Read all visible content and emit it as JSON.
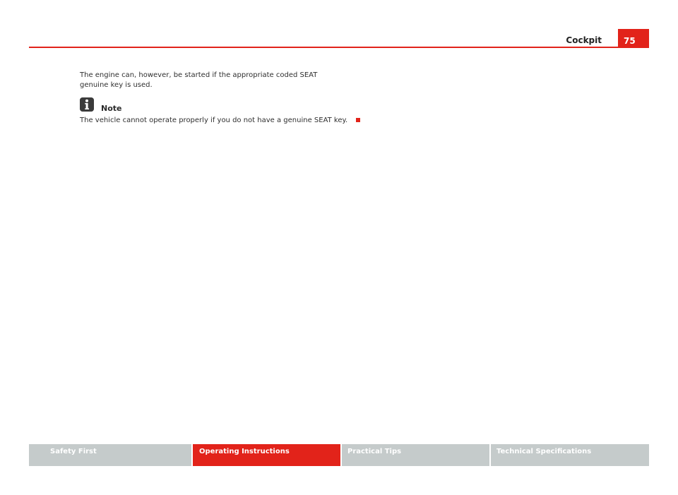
{
  "header": {
    "section_title": "Cockpit",
    "page_number": "75"
  },
  "content": {
    "paragraph": "The engine can, however, be started if the appropriate coded SEAT genuine key is used.",
    "note": {
      "icon": "info-i-icon",
      "heading": "Note",
      "text": "The vehicle cannot operate properly if you do not have a genuine SEAT key."
    }
  },
  "footer": {
    "tabs": [
      {
        "label": "Safety First",
        "active": false
      },
      {
        "label": "Operating Instructions",
        "active": true
      },
      {
        "label": "Practical Tips",
        "active": false
      },
      {
        "label": "Technical Specifications",
        "active": false
      }
    ]
  },
  "colors": {
    "accent": "#e2231a",
    "tab_inactive": "#c5cbcb"
  }
}
